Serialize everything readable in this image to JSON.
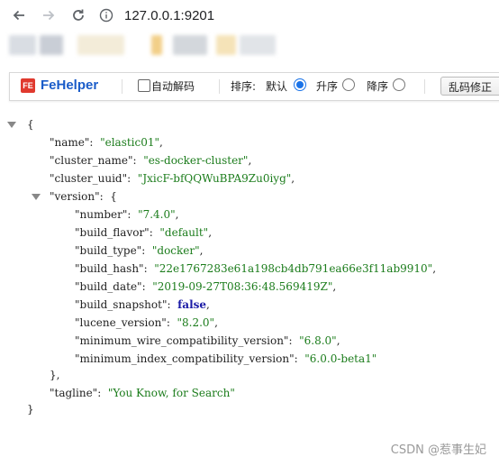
{
  "browser": {
    "url": "127.0.0.1:9201"
  },
  "fehelper": {
    "title": "FeHelper",
    "logo_text": "FE",
    "auto_decode_label": "自动解码",
    "sort_label": "排序:",
    "sort_options": [
      "默认",
      "升序",
      "降序"
    ],
    "sort_selected": "默认",
    "fix_button": "乱码修正"
  },
  "json": {
    "open_brace": "{",
    "close_brace": "}",
    "name_key": "\"name\"",
    "name_val": "\"elastic01\"",
    "cluster_name_key": "\"cluster_name\"",
    "cluster_name_val": "\"es-docker-cluster\"",
    "cluster_uuid_key": "\"cluster_uuid\"",
    "cluster_uuid_val": "\"JxicF-bfQQWuBPA9Zu0iyg\"",
    "version_key": "\"version\"",
    "version_close": "},",
    "number_key": "\"number\"",
    "number_val": "\"7.4.0\"",
    "build_flavor_key": "\"build_flavor\"",
    "build_flavor_val": "\"default\"",
    "build_type_key": "\"build_type\"",
    "build_type_val": "\"docker\"",
    "build_hash_key": "\"build_hash\"",
    "build_hash_val": "\"22e1767283e61a198cb4db791ea66e3f11ab9910\"",
    "build_date_key": "\"build_date\"",
    "build_date_val": "\"2019-09-27T08:36:48.569419Z\"",
    "build_snapshot_key": "\"build_snapshot\"",
    "build_snapshot_val": "false",
    "lucene_version_key": "\"lucene_version\"",
    "lucene_version_val": "\"8.2.0\"",
    "min_wire_key": "\"minimum_wire_compatibility_version\"",
    "min_wire_val": "\"6.8.0\"",
    "min_index_key": "\"minimum_index_compatibility_version\"",
    "min_index_val": "\"6.0.0-beta1\"",
    "tagline_key": "\"tagline\"",
    "tagline_val": "\"You Know, for Search\""
  },
  "watermark": "CSDN @惹事生妃",
  "colors": {
    "json_key": "#222222",
    "json_string": "#1b7c1b",
    "json_keyword": "#1a1aa6",
    "fehelper_brand": "#1a5cc9",
    "radio_selected": "#1a73e8"
  },
  "icons": [
    "back-arrow-icon",
    "forward-arrow-icon",
    "reload-icon",
    "info-icon",
    "fehelper-logo-icon",
    "collapse-triangle-icon"
  ]
}
